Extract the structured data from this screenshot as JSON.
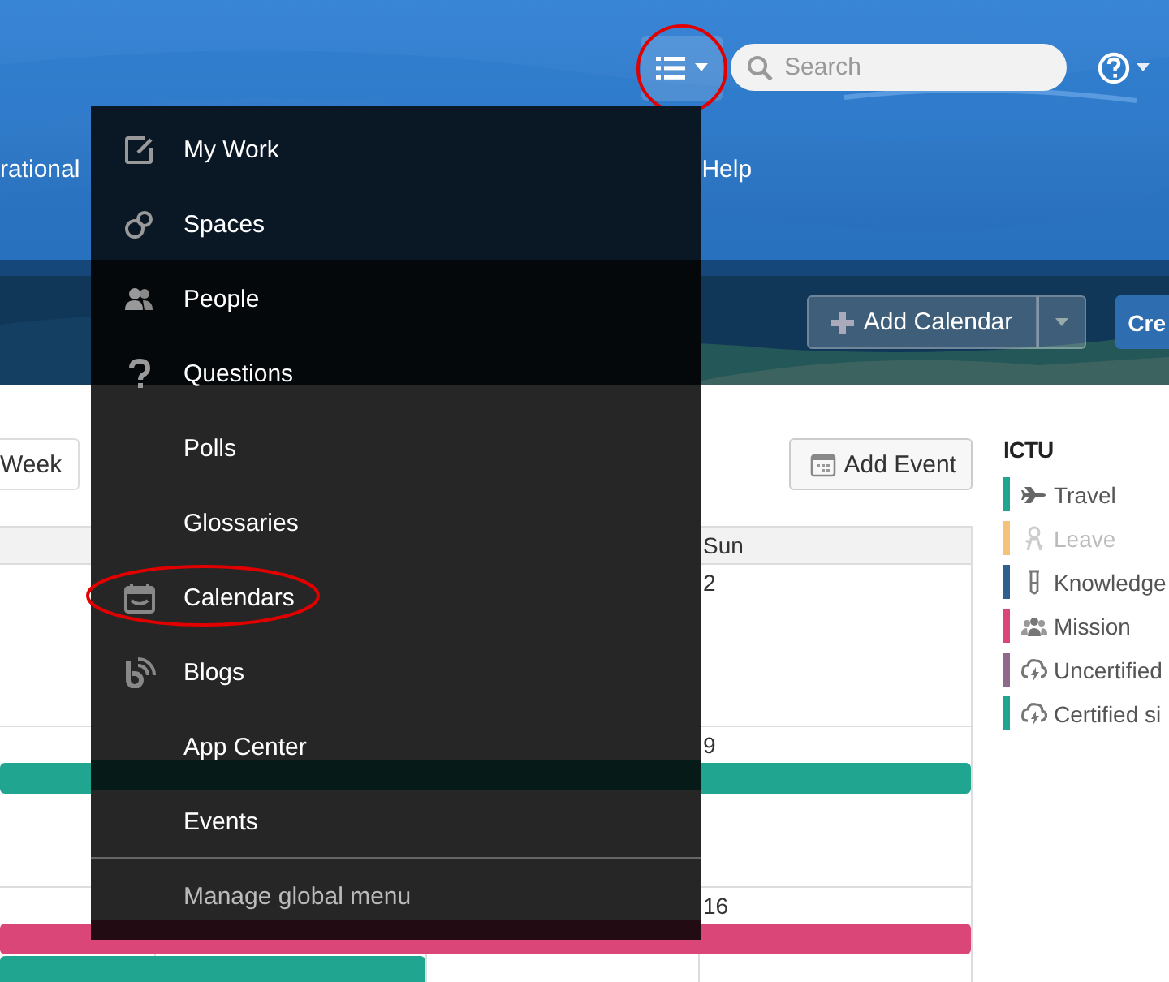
{
  "header": {
    "menu_button": {
      "circled": true
    },
    "search": {
      "placeholder": "Search"
    }
  },
  "nav": [
    "rational",
    "Help"
  ],
  "actions": {
    "add_calendar": "Add Calendar",
    "create": "Cre"
  },
  "views": [
    "Week"
  ],
  "add_event": "Add Event",
  "calendar": {
    "last_column_header": "Sun",
    "weeks": [
      {
        "last_column_date": "2"
      },
      {
        "last_column_date": "9",
        "bars": [
          {
            "color": "#20a591",
            "kind": "full"
          }
        ]
      },
      {
        "last_column_date": "16",
        "bars": [
          {
            "color": "#d94677",
            "kind": "full"
          },
          {
            "color": "#20a591",
            "kind": "partial"
          }
        ]
      }
    ]
  },
  "legend": {
    "title": "ICTU",
    "items": [
      {
        "label": "Travel",
        "color": "#20a591",
        "disabled": false
      },
      {
        "label": "Leave",
        "color": "#f5c27c",
        "disabled": true
      },
      {
        "label": "Knowledge",
        "color": "#2f5f8f",
        "disabled": false
      },
      {
        "label": "Mission",
        "color": "#d94677",
        "disabled": false
      },
      {
        "label": "Uncertified",
        "color": "#8d6a8c",
        "disabled": false
      },
      {
        "label": "Certified si",
        "color": "#20a591",
        "disabled": false
      }
    ]
  },
  "global_menu": {
    "items": [
      {
        "label": "My Work",
        "circled": false
      },
      {
        "label": "Spaces",
        "circled": false
      },
      {
        "label": "People",
        "circled": false
      },
      {
        "label": "Questions",
        "circled": false
      },
      {
        "label": "Polls",
        "circled": false
      },
      {
        "label": "Glossaries",
        "circled": false
      },
      {
        "label": "Calendars",
        "circled": true
      },
      {
        "label": "Blogs",
        "circled": false
      },
      {
        "label": "App Center",
        "circled": false
      },
      {
        "label": "Events",
        "circled": false
      }
    ],
    "footer": "Manage global menu"
  }
}
